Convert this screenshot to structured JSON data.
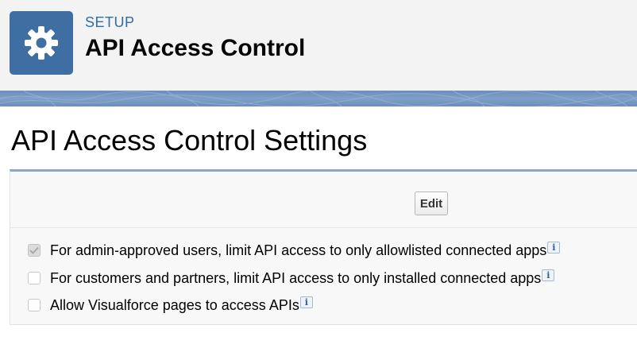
{
  "header": {
    "eyebrow": "SETUP",
    "title": "API Access Control",
    "icon": "gear-icon"
  },
  "section": {
    "title": "API Access Control Settings"
  },
  "toolbar": {
    "edit_label": "Edit"
  },
  "options": [
    {
      "label": "For admin-approved users, limit API access to only allowlisted connected apps",
      "checked": true,
      "disabled": true,
      "info": "i"
    },
    {
      "label": "For customers and partners, limit API access to only installed connected apps",
      "checked": false,
      "disabled": true,
      "info": "i"
    },
    {
      "label": "Allow Visualforce pages to access APIs",
      "checked": false,
      "disabled": true,
      "info": "i"
    }
  ],
  "colors": {
    "icon_tile": "#3f6ea3",
    "eyebrow": "#2e6ea6",
    "band": "#7ea0c9"
  }
}
